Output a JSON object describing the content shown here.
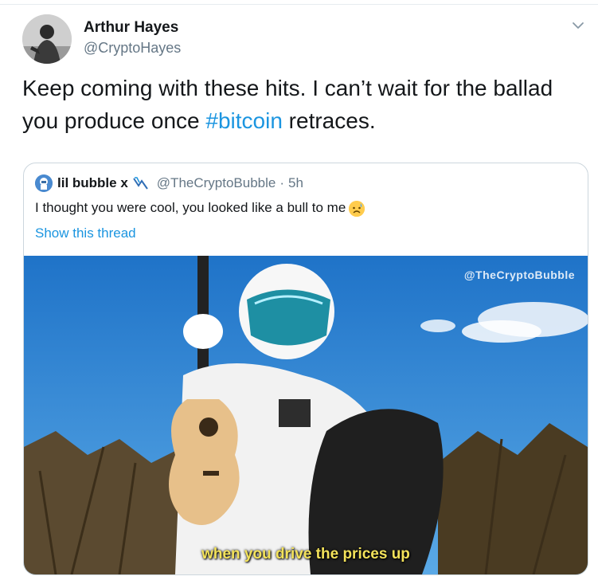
{
  "tweet": {
    "author_name": "Arthur Hayes",
    "author_handle": "@CryptoHayes",
    "text_before": "Keep coming with these hits. I can’t wait for the ballad you produce once ",
    "hashtag": "#bitcoin",
    "text_after": " retraces.",
    "menu_icon": "chevron-down-icon",
    "avatar": "avatar-photo"
  },
  "quoted": {
    "author_name": "lil bubble x",
    "author_handle": "@TheCryptoBubble",
    "separator": "·",
    "time": "5h",
    "text": "I thought you were cool, you looked like a bull to me",
    "emoji": "sad-sweat-emoji",
    "link": "Show this thread",
    "media": {
      "watermark": "@TheCryptoBubble",
      "caption": "when you drive the prices up"
    }
  },
  "colors": {
    "link": "#1b95e0",
    "secondary_text": "#657786",
    "border": "#ccd6dd",
    "caption": "#f3e25a"
  }
}
